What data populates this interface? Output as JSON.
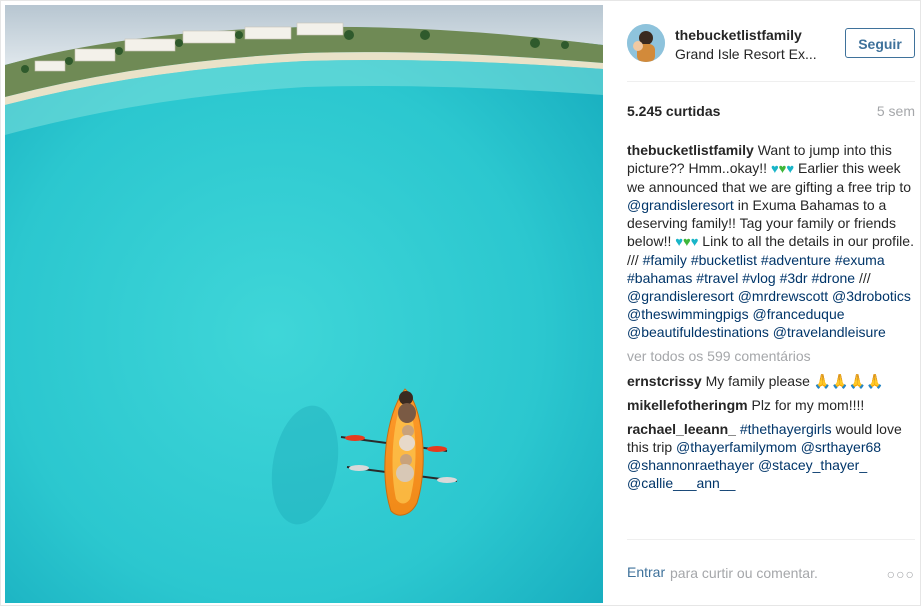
{
  "post": {
    "owner": "thebucketlistfamily",
    "location": "Grand Isle Resort Ex...",
    "follow_label": "Seguir",
    "likes": "5.245 curtidas",
    "time": "5 sem"
  },
  "caption": {
    "user": "thebucketlistfamily",
    "t1": "Want to jump into this picture?? Hmm..okay!! ",
    "t2": " Earlier this week we announced that we are gifting a free trip to ",
    "m_grandisle": "@grandisleresort",
    "t3": " in Exuma Bahamas to a deserving family!! Tag your family or friends below!! ",
    "t4": " Link to all the details in our profile. /// ",
    "h_family": "#family",
    "h_bucketlist": "#bucketlist",
    "h_adventure": "#adventure",
    "h_exuma": "#exuma",
    "h_bahamas": "#bahamas",
    "h_travel": "#travel",
    "h_vlog": "#vlog",
    "h_3dr": "#3dr",
    "h_drone": "#drone",
    "slashes": " /// ",
    "m_grandisle2": "@grandisleresort",
    "m_mrdrewscott": "@mrdrewscott",
    "m_3drobotics": "@3drobotics",
    "m_swimmingpigs": "@theswimmingpigs",
    "m_franceduque": "@franceduque",
    "m_beautiful": "@beautifuldestinations",
    "m_travelandleisure": "@travelandleisure"
  },
  "hearts": {
    "blue": "♥",
    "green": "♥"
  },
  "view_all": "ver todos os 599 comentários",
  "comments": [
    {
      "user": "ernstcrissy",
      "text": "My family please ",
      "emoji": "🙏🙏🙏🙏"
    },
    {
      "user": "mikellefotheringm",
      "text": "Plz for my mom!!!!"
    },
    {
      "user": "rachael_leeann_",
      "tag1": "#thethayergirls",
      "t1": " would love this trip ",
      "m1": "@thayerfamilymom",
      "m2": "@srthayer68",
      "m3": "@shannonraethayer",
      "m4": "@stacey_thayer_",
      "m5": "@callie___ann__"
    }
  ],
  "footer": {
    "like_label": "Entrar",
    "comment_placeholder": "para curtir ou comentar.",
    "more_label": "○○○"
  },
  "colors": {
    "link": "#003569",
    "follow": "#3f729b",
    "muted": "#a5a7aa",
    "water": "#2ccad0"
  },
  "icons": {
    "heart": "heart-icon",
    "more": "more-options-icon"
  }
}
